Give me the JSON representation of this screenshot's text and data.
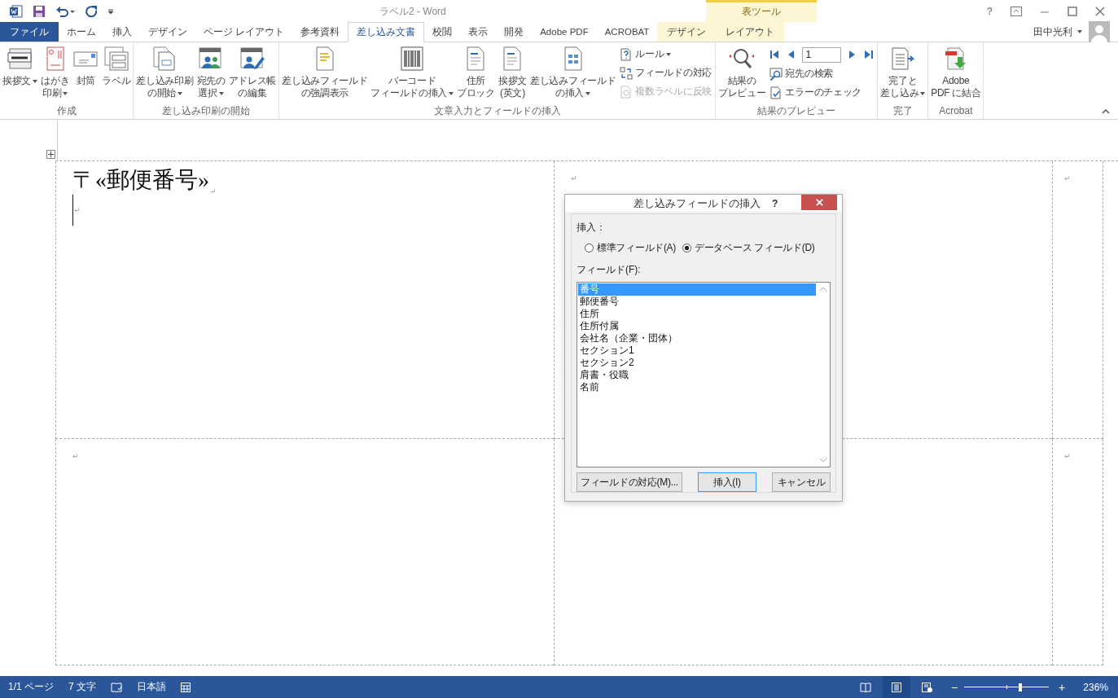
{
  "window": {
    "title": "ラベル2 - Word",
    "context_tools": "表ツール",
    "help": "?",
    "user": "田中光利"
  },
  "tabs": [
    {
      "label": "ファイル",
      "kind": "file",
      "selected": false
    },
    {
      "label": "ホーム",
      "kind": "normal",
      "selected": false
    },
    {
      "label": "挿入",
      "kind": "normal",
      "selected": false
    },
    {
      "label": "デザイン",
      "kind": "normal",
      "selected": false
    },
    {
      "label": "ページ レイアウト",
      "kind": "normal",
      "selected": false
    },
    {
      "label": "参考資料",
      "kind": "normal",
      "selected": false
    },
    {
      "label": "差し込み文書",
      "kind": "normal",
      "selected": true
    },
    {
      "label": "校閲",
      "kind": "normal",
      "selected": false
    },
    {
      "label": "表示",
      "kind": "normal",
      "selected": false
    },
    {
      "label": "開発",
      "kind": "normal",
      "selected": false
    },
    {
      "label": "Adobe  PDF",
      "kind": "normal",
      "selected": false
    },
    {
      "label": "ACROBAT",
      "kind": "normal",
      "selected": false
    },
    {
      "label": "デザイン",
      "kind": "context",
      "selected": false
    },
    {
      "label": "レイアウト",
      "kind": "context",
      "selected": false
    }
  ],
  "ribbon": {
    "groups": [
      {
        "label": "作成",
        "large": [
          {
            "lines": [
              "挨拶文"
            ],
            "dropdown": true,
            "kind": "greeting"
          },
          {
            "lines": [
              "はがき",
              "印刷"
            ],
            "dropdown": true,
            "kind": "postcard"
          },
          {
            "lines": [
              "封筒"
            ],
            "dropdown": false,
            "kind": "envelope"
          },
          {
            "lines": [
              "ラベル"
            ],
            "dropdown": false,
            "kind": "labels"
          }
        ]
      },
      {
        "label": "差し込み印刷の開始",
        "large": [
          {
            "lines": [
              "差し込み印刷",
              "の開始"
            ],
            "dropdown": true,
            "kind": "start"
          },
          {
            "lines": [
              "宛先の",
              "選択"
            ],
            "dropdown": true,
            "kind": "people"
          },
          {
            "lines": [
              "アドレス帳",
              "の編集"
            ],
            "dropdown": false,
            "kind": "addressbook"
          }
        ]
      },
      {
        "label": "文章入力とフィールドの挿入",
        "large": [
          {
            "lines": [
              "差し込みフィールド",
              "の強調表示"
            ],
            "dropdown": false,
            "kind": "highlight"
          },
          {
            "lines": [
              "バーコード",
              "フィールドの挿入"
            ],
            "dropdown": true,
            "kind": "barcode"
          },
          {
            "lines": [
              "住所",
              "ブロック"
            ],
            "dropdown": false,
            "kind": "address"
          },
          {
            "lines": [
              "挨拶文",
              "(英文)"
            ],
            "dropdown": false,
            "kind": "letter"
          },
          {
            "lines": [
              "差し込みフィールド",
              "の挿入"
            ],
            "dropdown": true,
            "kind": "fields"
          }
        ],
        "small": [
          {
            "label": "ルール",
            "dropdown": true,
            "disabled": false,
            "kind": "rule"
          },
          {
            "label": "フィールドの対応",
            "dropdown": false,
            "disabled": false,
            "kind": "match"
          },
          {
            "label": "複数ラベルに反映",
            "dropdown": false,
            "disabled": true,
            "kind": "update"
          }
        ]
      },
      {
        "label": "結果のプレビュー",
        "large": [
          {
            "lines": [
              "結果の",
              "プレビュー"
            ],
            "dropdown": false,
            "kind": "preview"
          }
        ],
        "navigator": {
          "record": "1"
        },
        "small": [
          {
            "label": "宛先の検索",
            "dropdown": false,
            "disabled": false,
            "kind": "find"
          },
          {
            "label": "エラーのチェック",
            "dropdown": false,
            "disabled": false,
            "kind": "check"
          }
        ]
      },
      {
        "label": "完了",
        "large": [
          {
            "lines": [
              "完了と",
              "差し込み"
            ],
            "dropdown": true,
            "kind": "finish"
          }
        ]
      },
      {
        "label": "Acrobat",
        "large": [
          {
            "lines": [
              "Adobe",
              "PDF に結合"
            ],
            "dropdown": false,
            "kind": "pdf"
          }
        ]
      }
    ]
  },
  "document": {
    "rows": [
      [
        {
          "lines": [
            {
              "kind": "field-line",
              "text": "〒«郵便番号»",
              "mark": "↵",
              "cursor": false
            },
            {
              "kind": "empty",
              "mark": "↵",
              "cursor": true
            }
          ]
        },
        {
          "lines": [
            {
              "kind": "empty",
              "mark": "↵",
              "cursor": false
            }
          ]
        },
        {
          "lines": [
            {
              "kind": "empty",
              "mark": "↵",
              "cursor": false
            }
          ]
        }
      ],
      [
        {
          "lines": [
            {
              "kind": "empty",
              "mark": "↵",
              "cursor": false
            }
          ]
        },
        {},
        {
          "lines": [
            {
              "kind": "empty",
              "mark": "↵",
              "cursor": false
            }
          ]
        }
      ]
    ]
  },
  "dialog": {
    "title": "差し込みフィールドの挿入",
    "help": "?",
    "insert_label": "挿入：",
    "options": [
      {
        "label": "標準フィールド(A)",
        "selected": false
      },
      {
        "label": "データベース フィールド(D)",
        "selected": true
      }
    ],
    "fields_label": "フィールド(F):",
    "fields": [
      {
        "label": "番号",
        "selected": true
      },
      {
        "label": "郵便番号",
        "selected": false
      },
      {
        "label": "住所",
        "selected": false
      },
      {
        "label": "住所付属",
        "selected": false
      },
      {
        "label": "会社名（企業・団体）",
        "selected": false
      },
      {
        "label": "セクション1",
        "selected": false
      },
      {
        "label": "セクション2",
        "selected": false
      },
      {
        "label": "肩書・役職",
        "selected": false
      },
      {
        "label": "名前",
        "selected": false
      }
    ],
    "buttons": [
      {
        "label": "フィールドの対応(M)...",
        "default": false
      },
      {
        "label": "挿入(I)",
        "default": true
      },
      {
        "label": "キャンセル",
        "default": false
      }
    ]
  },
  "status_bar": {
    "items": [
      {
        "kind": "text",
        "label": "1/1 ページ"
      },
      {
        "kind": "text",
        "label": "7 文字"
      },
      {
        "kind": "proofing"
      },
      {
        "kind": "text",
        "label": "日本語"
      },
      {
        "kind": "macro"
      }
    ],
    "views": [
      {
        "kind": "read",
        "selected": false
      },
      {
        "kind": "print",
        "selected": true
      },
      {
        "kind": "web",
        "selected": false
      }
    ],
    "zoom": {
      "minus": "−",
      "plus": "+",
      "level": 0.66,
      "reading": "236%"
    }
  }
}
